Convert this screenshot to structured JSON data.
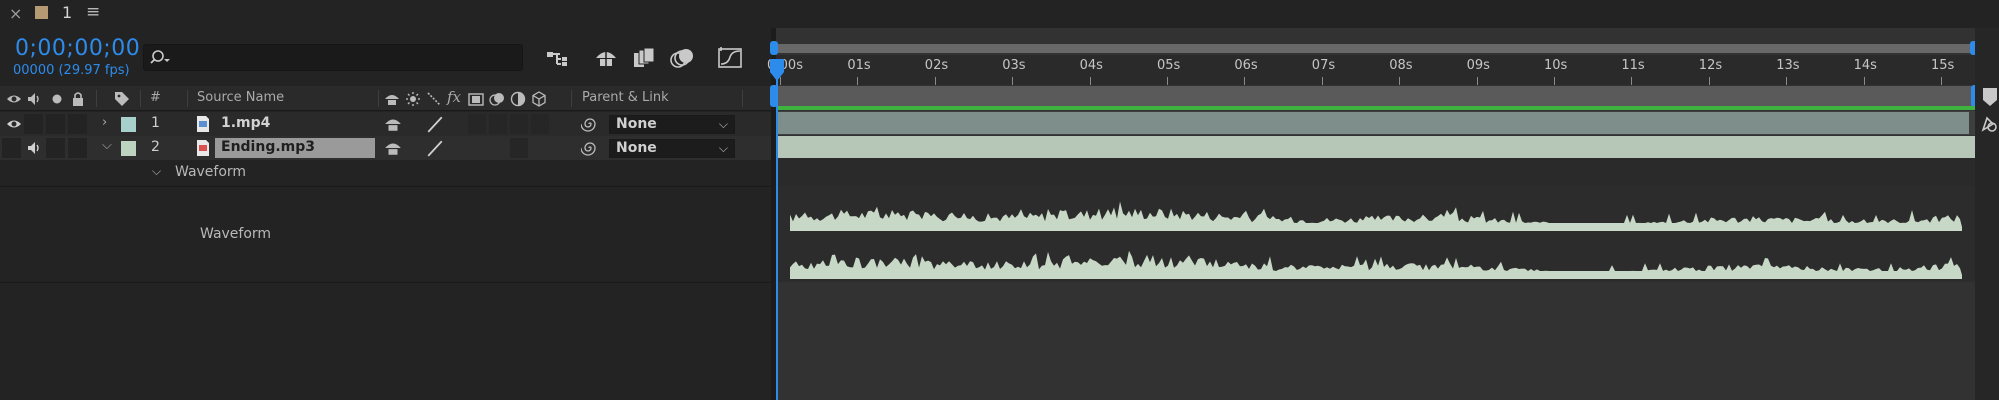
{
  "tab": {
    "close": "×",
    "name": "1",
    "menu": "≡",
    "swatch_color": "#b59a73"
  },
  "header": {
    "timecode": "0;00;00;00",
    "frame_count": "00000 (29.97 fps)",
    "search_placeholder": "",
    "tools": [
      "draft-3d-icon",
      "shy-layers-icon",
      "frame-blending-icon",
      "motion-blur-icon",
      "graph-editor-icon"
    ]
  },
  "columns": {
    "number": "#",
    "source_name": "Source Name",
    "parent_link": "Parent & Link"
  },
  "layers": [
    {
      "number": "1",
      "name": "1.mp4",
      "label_color": "#a7cfcb",
      "parent": "None",
      "type": "video",
      "selected": false
    },
    {
      "number": "2",
      "name": "Ending.mp3",
      "label_color": "#bcd3bf",
      "parent": "None",
      "type": "audio",
      "selected": true
    }
  ],
  "waveform_group": {
    "label": "Waveform",
    "row_label": "Waveform"
  },
  "timeline": {
    "ruler_labels": [
      "0:00s",
      "01s",
      "02s",
      "03s",
      "04s",
      "05s",
      "06s",
      "07s",
      "08s",
      "09s",
      "10s",
      "11s",
      "12s",
      "13s",
      "14s",
      "15s"
    ],
    "accent_color": "#2d8ceb",
    "video_bar_color": "#7e8e8b",
    "audio_bar_color": "#b7c7b7",
    "work_area_color": "#3fb340"
  }
}
